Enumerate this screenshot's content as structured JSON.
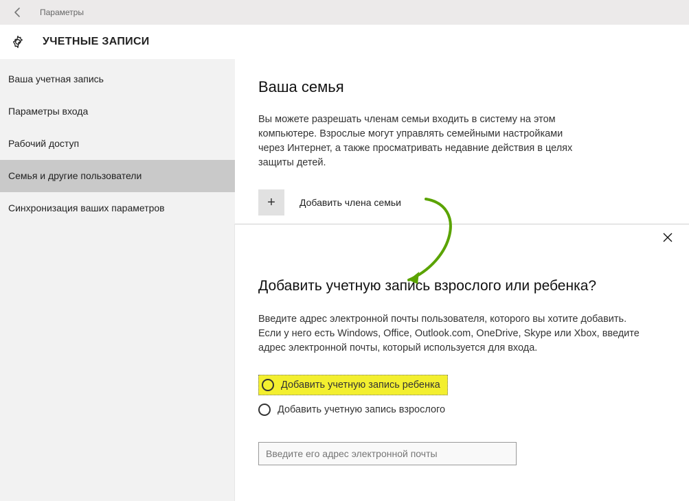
{
  "titlebar": {
    "title": "Параметры"
  },
  "header": {
    "title": "УЧЕТНЫЕ ЗАПИСИ"
  },
  "sidebar": {
    "items": [
      {
        "label": "Ваша учетная запись"
      },
      {
        "label": "Параметры входа"
      },
      {
        "label": "Рабочий доступ"
      },
      {
        "label": "Семья и другие пользователи"
      },
      {
        "label": "Синхронизация ваших параметров"
      }
    ],
    "selectedIndex": 3
  },
  "main": {
    "heading": "Ваша семья",
    "description": "Вы можете разрешать членам семьи входить в систему на этом компьютере. Взрослые могут управлять семейными настройками через Интернет, а также просматривать недавние действия в целях защиты детей.",
    "addFamily": "Добавить члена семьи"
  },
  "dialog": {
    "heading": "Добавить учетную запись взрослого или ребенка?",
    "description": "Введите адрес электронной почты пользователя, которого вы хотите добавить. Если у него есть Windows, Office, Outlook.com, OneDrive, Skype или Xbox, введите адрес электронной почты, который используется для входа.",
    "options": [
      {
        "label": "Добавить учетную запись ребенка"
      },
      {
        "label": "Добавить учетную запись взрослого"
      }
    ],
    "highlightedIndex": 0,
    "emailPlaceholder": "Введите его адрес электронной почты"
  },
  "colors": {
    "highlight": "#f3ef2f",
    "arrow": "#5aa300"
  }
}
